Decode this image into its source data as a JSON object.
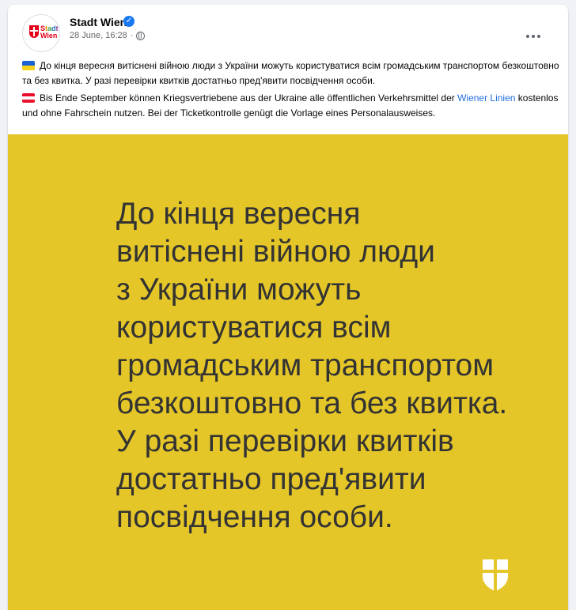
{
  "post": {
    "page_name": "Stadt Wien",
    "timestamp": "28 June, 16:28",
    "separator": "·",
    "avatar_text": [
      "Stadt",
      "Wien"
    ]
  },
  "body": {
    "ua_text": "До кінця вересня витіснені війною люди з України можуть користуватися всім громадським транспортом безкоштовно та без квитка. У разі перевірки квитків достатньо пред'явити посвідчення особи.",
    "de_text_before": "Bis Ende September können Kriegsvertriebene aus der Ukraine alle öffentlichen Verkehrsmittel der ",
    "de_link": "Wiener Linien",
    "de_text_after": " kostenlos und ohne Fahrschein nutzen. Bei der Ticketkontrolle genügt die Vorlage eines Personalausweises."
  },
  "image": {
    "lines": [
      "До кінця вересня",
      "витіснені війною люди",
      "з України можуть",
      "користуватися всім",
      "громадським транспортом",
      "безкоштовно та без квитка.",
      "У разі перевірки квитків",
      "достатньо пред'явити",
      "посвідчення особи."
    ]
  },
  "colors": {
    "panel_yellow": "#e5c629",
    "link_blue": "#216fdb",
    "verified_blue": "#1877f2"
  },
  "icons": [
    "verified-badge-icon",
    "globe-icon",
    "more-options-icon",
    "ukraine-flag-icon",
    "austria-flag-icon",
    "vienna-shield-logo"
  ]
}
